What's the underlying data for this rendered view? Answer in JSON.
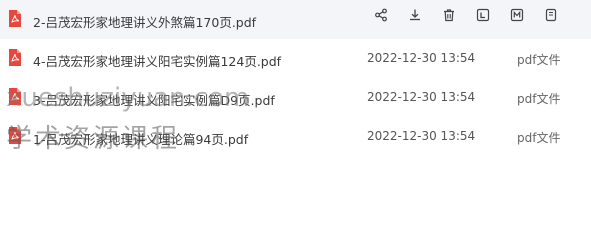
{
  "files": [
    {
      "name": "2-吕茂宏形家地理讲义外煞篇170页.pdf",
      "date": "",
      "type": ""
    },
    {
      "name": "4-吕茂宏形家地理讲义阳宅实例篇124页.pdf",
      "date": "2022-12-30 13:54",
      "type": "pdf文件"
    },
    {
      "name": "3-吕茂宏形家地理讲义阳宅实例篇D9页.pdf",
      "date": "2022-12-30 13:54",
      "type": "pdf文件"
    },
    {
      "name": "1-吕茂宏形家地理讲义理论篇94页.pdf",
      "date": "2022-12-30 13:54",
      "type": "pdf文件"
    }
  ],
  "actions": [
    "share-icon",
    "download-icon",
    "delete-icon",
    "text-icon",
    "translate-icon",
    "more-icon"
  ],
  "watermark": {
    "line1": "xueshuziyuan.com",
    "line2": "学术资源课程"
  },
  "colors": {
    "pdf_red": "#e5483e",
    "icon_gray": "#444444",
    "hover_bg": "#f3f5f9"
  }
}
